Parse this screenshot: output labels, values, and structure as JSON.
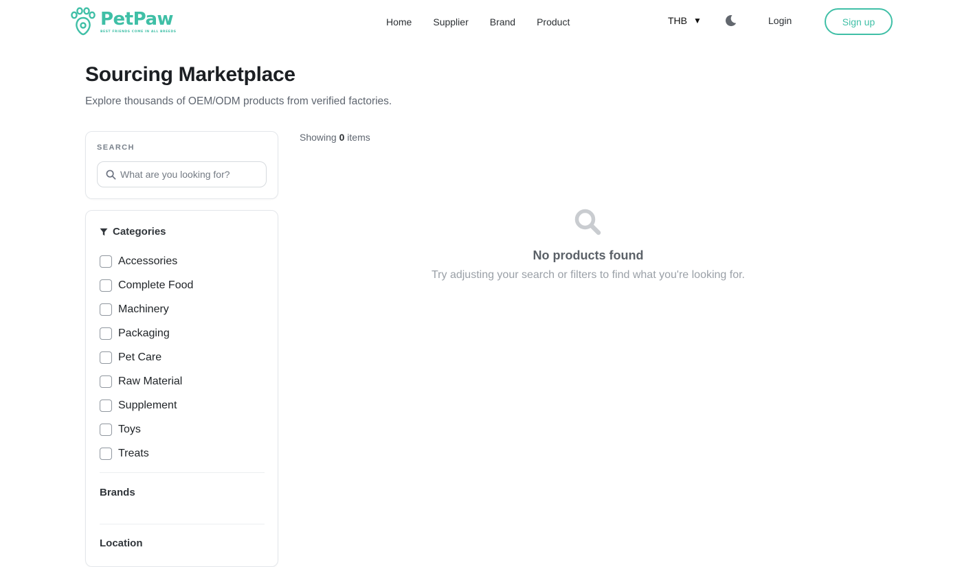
{
  "brand": {
    "name": "PetPaw",
    "tagline": "BEST FRIENDS COME IN ALL BREEDS",
    "color": "#3fbfa6"
  },
  "nav": {
    "items": [
      "Home",
      "Supplier",
      "Brand",
      "Product"
    ]
  },
  "header": {
    "currency": "THB",
    "currency_caret": "▼",
    "theme_icon": "moon-icon",
    "login_label": "Login",
    "signup_label": "Sign up"
  },
  "page": {
    "title": "Sourcing Marketplace",
    "subtitle": "Explore thousands of OEM/ODM products from verified factories."
  },
  "search": {
    "label": "SEARCH",
    "placeholder": "What are you looking for?",
    "value": ""
  },
  "filters": {
    "categories_title": "Categories",
    "categories": [
      "Accessories",
      "Complete Food",
      "Machinery",
      "Packaging",
      "Pet Care",
      "Raw Material",
      "Supplement",
      "Toys",
      "Treats"
    ],
    "brands_title": "Brands",
    "location_title": "Location"
  },
  "results": {
    "showing_prefix": "Showing",
    "count": "0",
    "showing_suffix": "items",
    "empty_title": "No products found",
    "empty_text": "Try adjusting your search or filters to find what you're looking for."
  }
}
